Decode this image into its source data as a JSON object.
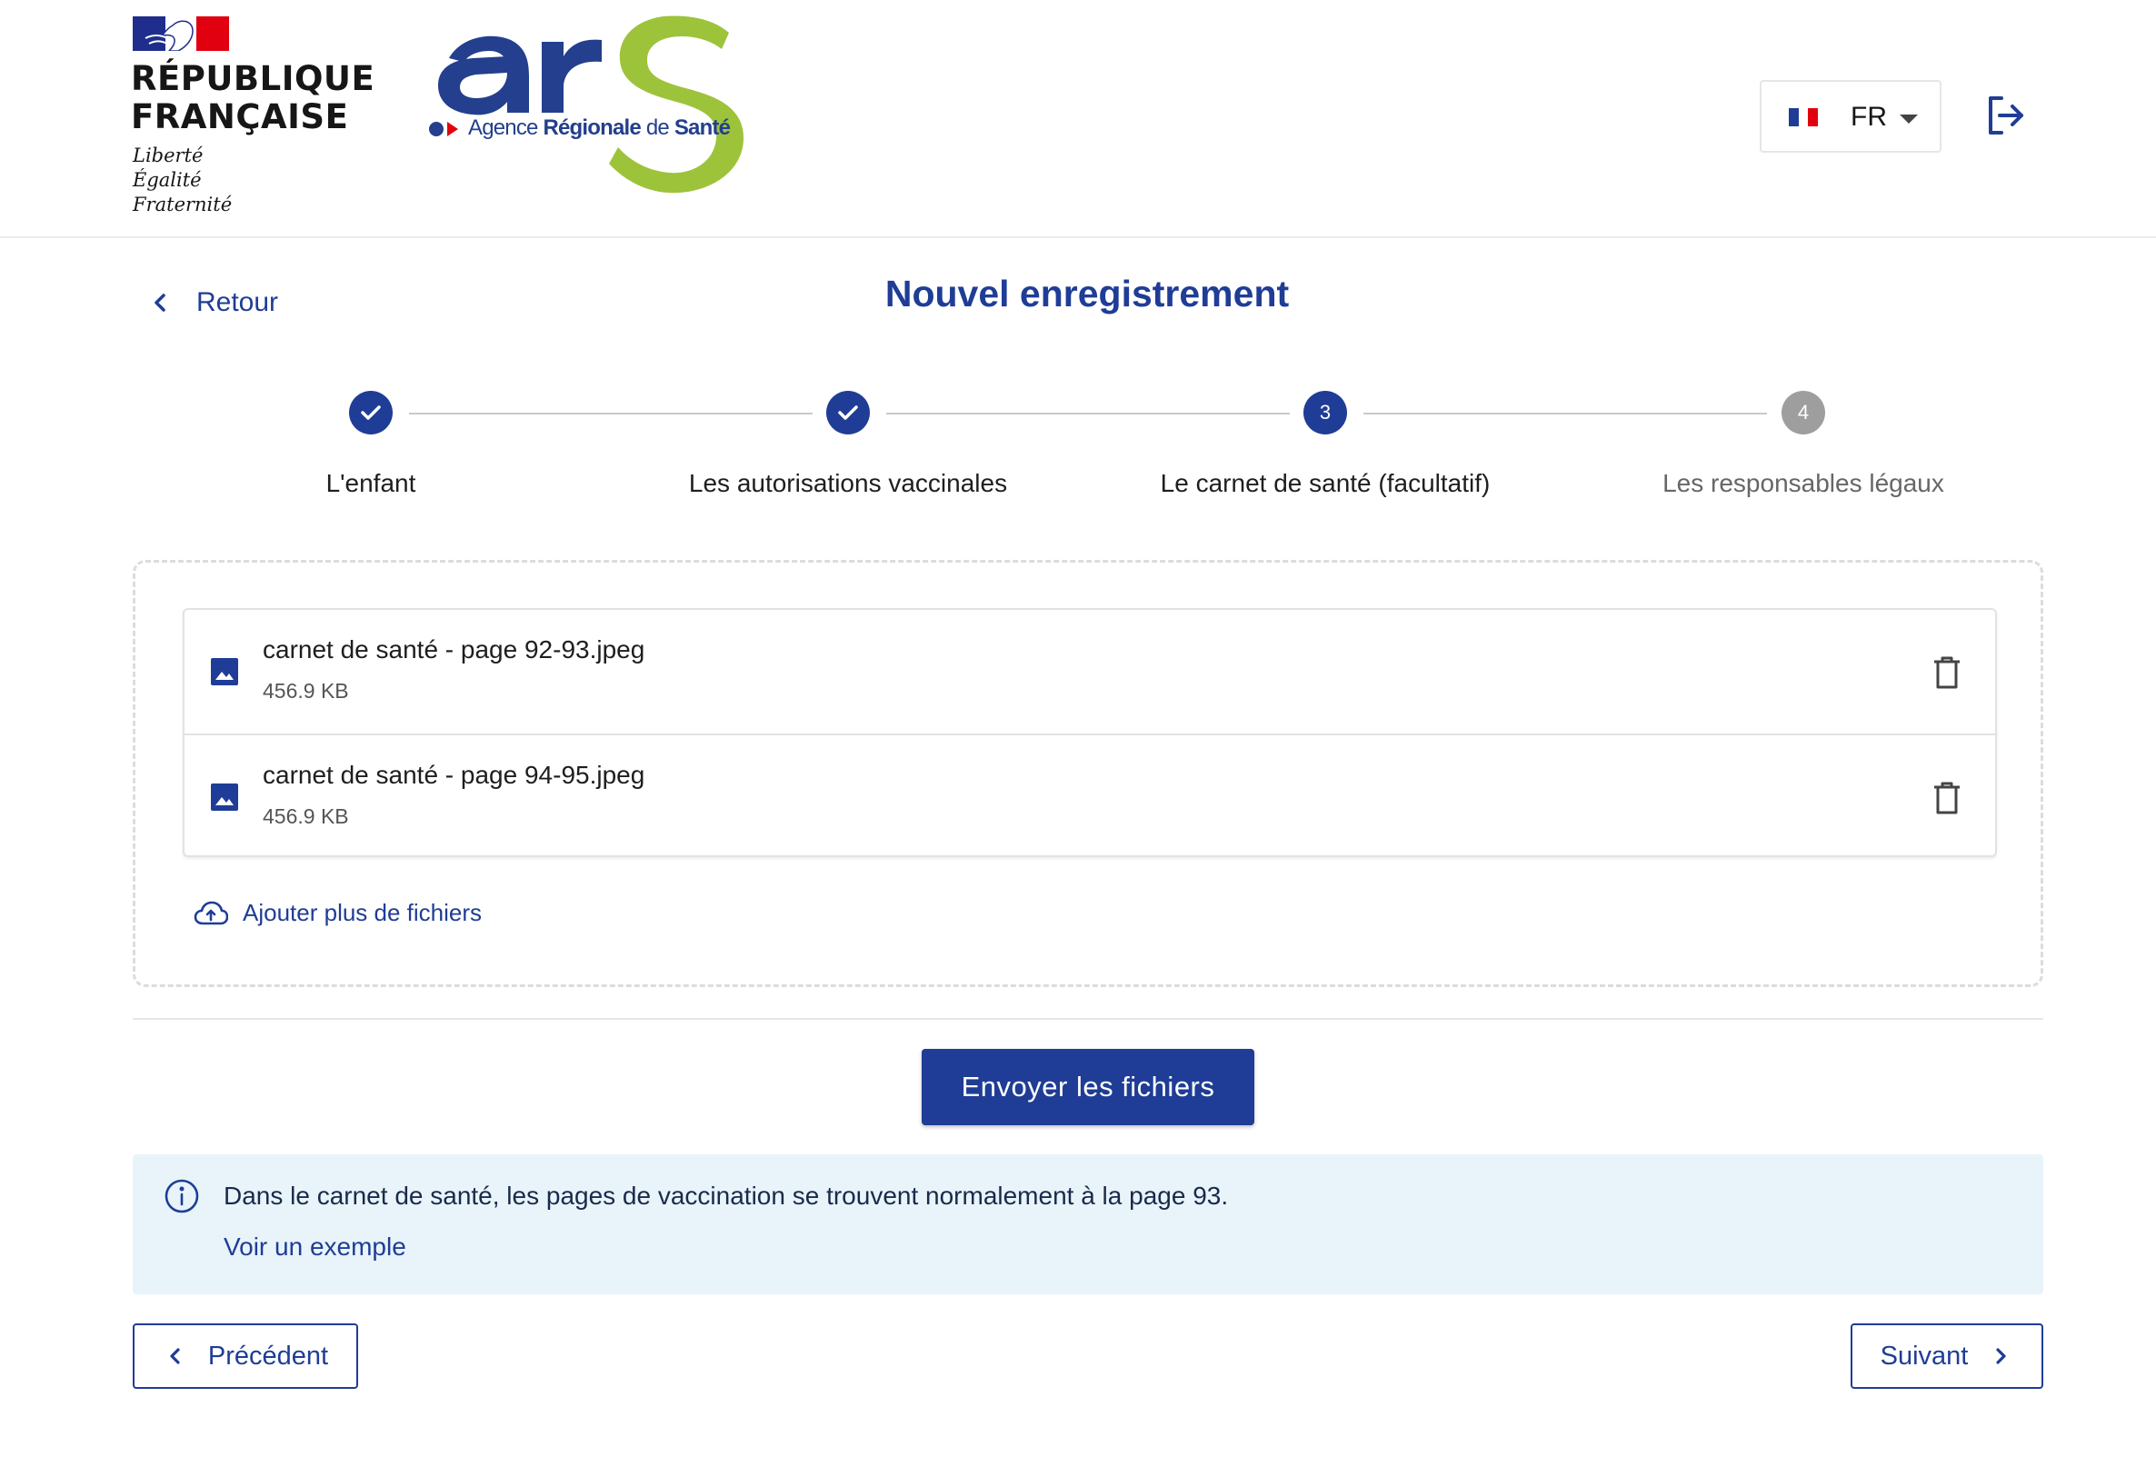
{
  "header": {
    "gov_logo": {
      "title_line1": "RÉPUBLIQUE",
      "title_line2": "FRANÇAISE",
      "motto_line1": "Liberté",
      "motto_line2": "Égalité",
      "motto_line3": "Fraternité"
    },
    "ars_logo": {
      "letters": "ars",
      "subtitle_part1": "Agence ",
      "subtitle_part2": "Régionale",
      "subtitle_part3": " de ",
      "subtitle_part4": "Santé"
    },
    "language": {
      "selected": "FR",
      "flag_icon": "french-flag-icon"
    },
    "logout_icon": "logout-icon"
  },
  "nav": {
    "back_label": "Retour",
    "page_title": "Nouvel enregistrement"
  },
  "stepper": {
    "steps": [
      {
        "label": "L'enfant",
        "number": "1",
        "state": "done"
      },
      {
        "label": "Les autorisations vaccinales",
        "number": "2",
        "state": "done"
      },
      {
        "label": "Le carnet de santé (facultatif)",
        "number": "3",
        "state": "active"
      },
      {
        "label": "Les responsables légaux",
        "number": "4",
        "state": "todo"
      }
    ]
  },
  "upload": {
    "files": [
      {
        "name": "carnet de santé - page 92-93.jpeg",
        "size": "456.9 KB"
      },
      {
        "name": "carnet de santé - page 94-95.jpeg",
        "size": "456.9 KB"
      }
    ],
    "add_files_label": "Ajouter plus de fichiers",
    "send_label": "Envoyer les fichiers"
  },
  "info": {
    "text": "Dans le carnet de santé, les pages de vaccination se trouvent normalement à la page 93.",
    "link_label": "Voir un exemple"
  },
  "footer_nav": {
    "prev_label": "Précédent",
    "next_label": "Suivant"
  },
  "colors": {
    "primary": "#1f3d96",
    "ars_green": "#9dc33b",
    "ars_blue": "#233f8d",
    "info_bg": "#e8f4fa",
    "inactive_step": "#9e9e9e"
  }
}
